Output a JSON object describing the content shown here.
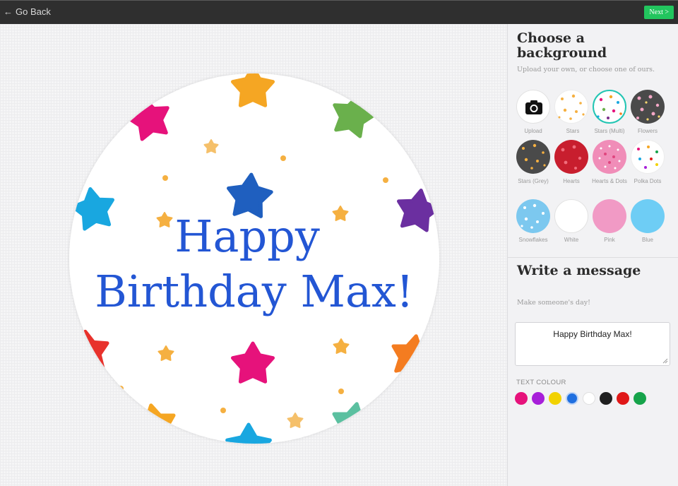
{
  "topbar": {
    "back_label": "Go Back",
    "next_label": "Next >"
  },
  "card": {
    "message": "Happy Birthday Max!",
    "message_lines": [
      "Happy",
      "Birthday Max!"
    ],
    "text_color": "#2356d4"
  },
  "background_section": {
    "title": "Choose a background",
    "subtitle": "Upload your own, or choose one of ours.",
    "options": [
      {
        "label": "Upload",
        "icon": "camera-icon"
      },
      {
        "label": "Stars"
      },
      {
        "label": "Stars (Multi)",
        "selected": true
      },
      {
        "label": "Flowers"
      },
      {
        "label": "Stars (Grey)"
      },
      {
        "label": "Hearts"
      },
      {
        "label": "Hearts & Dots"
      },
      {
        "label": "Polka Dots"
      },
      {
        "label": "Snowflakes"
      },
      {
        "label": "White"
      },
      {
        "label": "Pink"
      },
      {
        "label": "Blue"
      }
    ]
  },
  "message_section": {
    "title": "Write a message",
    "subtitle": "Make someone's day!",
    "value": "Happy Birthday Max!",
    "text_colour_label": "TEXT COLOUR",
    "colours": [
      "#e6127b",
      "#a71fd9",
      "#f2d200",
      "#1f6fe0",
      "#ffffff",
      "#1f1f1f",
      "#e01818",
      "#16a34a"
    ],
    "selected_colour": "#1f6fe0"
  }
}
